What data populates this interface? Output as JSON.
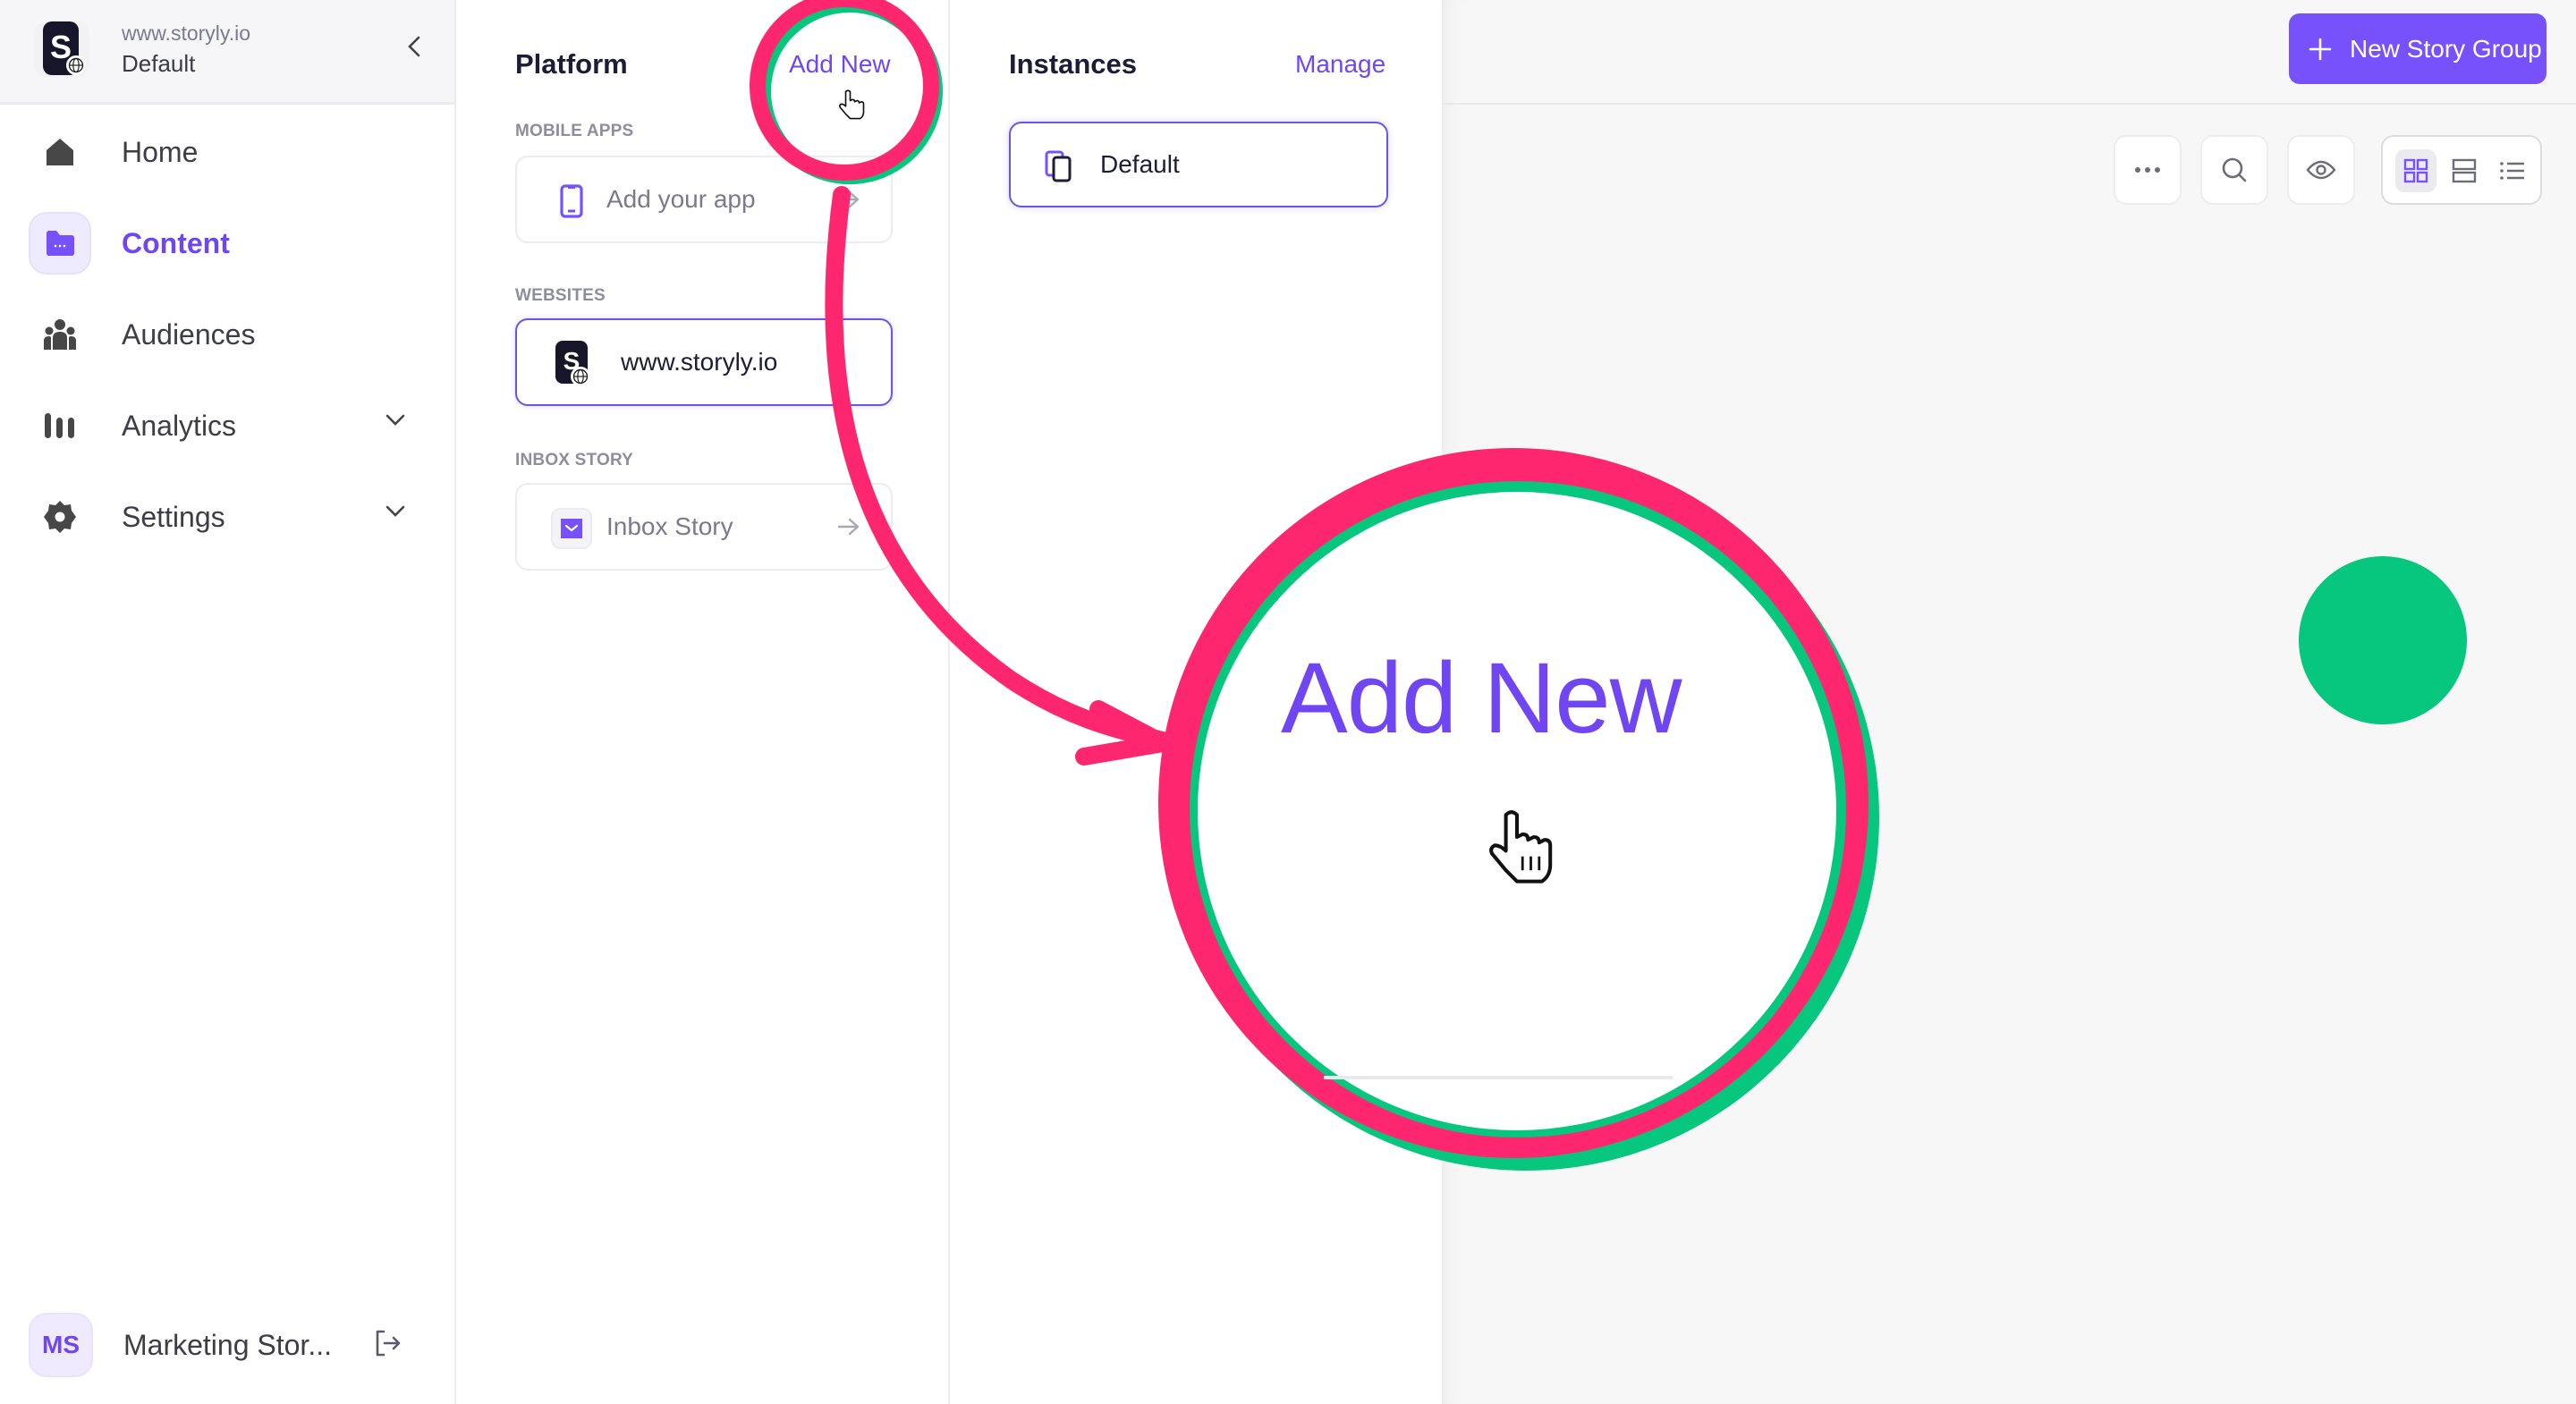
{
  "sidebar": {
    "workspace": {
      "site": "www.storyly.io",
      "instance": "Default",
      "logo_letter": "S"
    },
    "nav": [
      {
        "label": "Home",
        "icon": "home-icon",
        "active": false,
        "expandable": false
      },
      {
        "label": "Content",
        "icon": "folder-icon",
        "active": true,
        "expandable": false
      },
      {
        "label": "Audiences",
        "icon": "users-icon",
        "active": false,
        "expandable": false
      },
      {
        "label": "Analytics",
        "icon": "bar-chart-icon",
        "active": false,
        "expandable": true
      },
      {
        "label": "Settings",
        "icon": "gear-icon",
        "active": false,
        "expandable": true
      }
    ],
    "user": {
      "initials": "MS",
      "name": "Marketing Stor..."
    }
  },
  "platform": {
    "title": "Platform",
    "add_new": "Add New",
    "sections": [
      {
        "label": "MOBILE APPS",
        "item": {
          "label": "Add your app",
          "icon": "mobile-phone-icon",
          "selected": false
        }
      },
      {
        "label": "WEBSITES",
        "item": {
          "label": "www.storyly.io",
          "icon": "storyly-web-icon",
          "selected": true
        }
      },
      {
        "label": "INBOX STORY",
        "item": {
          "label": "Inbox Story",
          "icon": "inbox-icon",
          "selected": false
        }
      }
    ]
  },
  "instances": {
    "title": "Instances",
    "manage": "Manage",
    "items": [
      {
        "label": "Default",
        "icon": "copy-instance-icon",
        "selected": true
      }
    ]
  },
  "main": {
    "new_button": "New Story Group",
    "toolbar": [
      "more-options",
      "search",
      "preview",
      "grid-view",
      "row-view",
      "list-view"
    ],
    "active_view": "grid-view"
  },
  "annotation": {
    "magnified_text": "Add New",
    "colors": {
      "ring": "#ff2670",
      "ring_shadow": "#06c77d",
      "accent": "#7046f3",
      "primary_button": "#7752fc"
    }
  }
}
